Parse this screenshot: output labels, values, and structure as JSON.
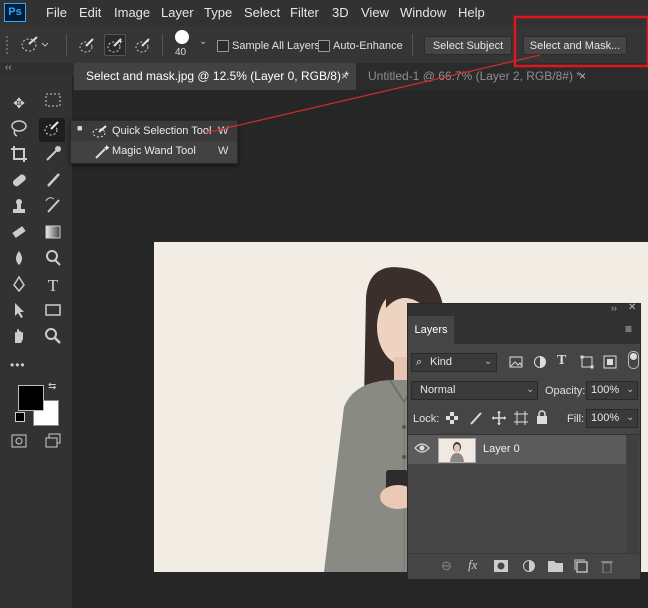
{
  "app": {
    "logo": "Ps"
  },
  "menu": [
    "File",
    "Edit",
    "Image",
    "Layer",
    "Type",
    "Select",
    "Filter",
    "3D",
    "View",
    "Window",
    "Help"
  ],
  "options": {
    "brush_size": "40",
    "sample_all_layers": "Sample All Layers",
    "auto_enhance": "Auto-Enhance",
    "select_subject": "Select Subject",
    "select_and_mask": "Select and Mask...",
    "highlight_color": "#e0161d"
  },
  "tabs": [
    {
      "label": "Select and mask.jpg @ 12.5% (Layer 0, RGB/8) *",
      "close": "×"
    },
    {
      "label": "Untitled-1 @ 66.7% (Layer 2, RGB/8#) *",
      "close": "×"
    }
  ],
  "grip": "‹‹",
  "flyout": {
    "items": [
      {
        "label": "Quick Selection Tool",
        "shortcut": "W"
      },
      {
        "label": "Magic Wand Tool",
        "shortcut": "W"
      }
    ]
  },
  "layers_panel": {
    "collapse": "››",
    "tab": "Layers",
    "filter_kind": "Kind",
    "blend_mode": "Normal",
    "opacity_label": "Opacity:",
    "opacity_value": "100%",
    "lock_label": "Lock:",
    "fill_label": "Fill:",
    "fill_value": "100%",
    "layer_name": "Layer 0",
    "footer_icons": [
      "link-icon",
      "fx-icon",
      "mask-icon",
      "adjustment-icon",
      "folder-icon",
      "new-layer-icon",
      "trash-icon"
    ]
  },
  "toolbar": {
    "more": "•••"
  }
}
